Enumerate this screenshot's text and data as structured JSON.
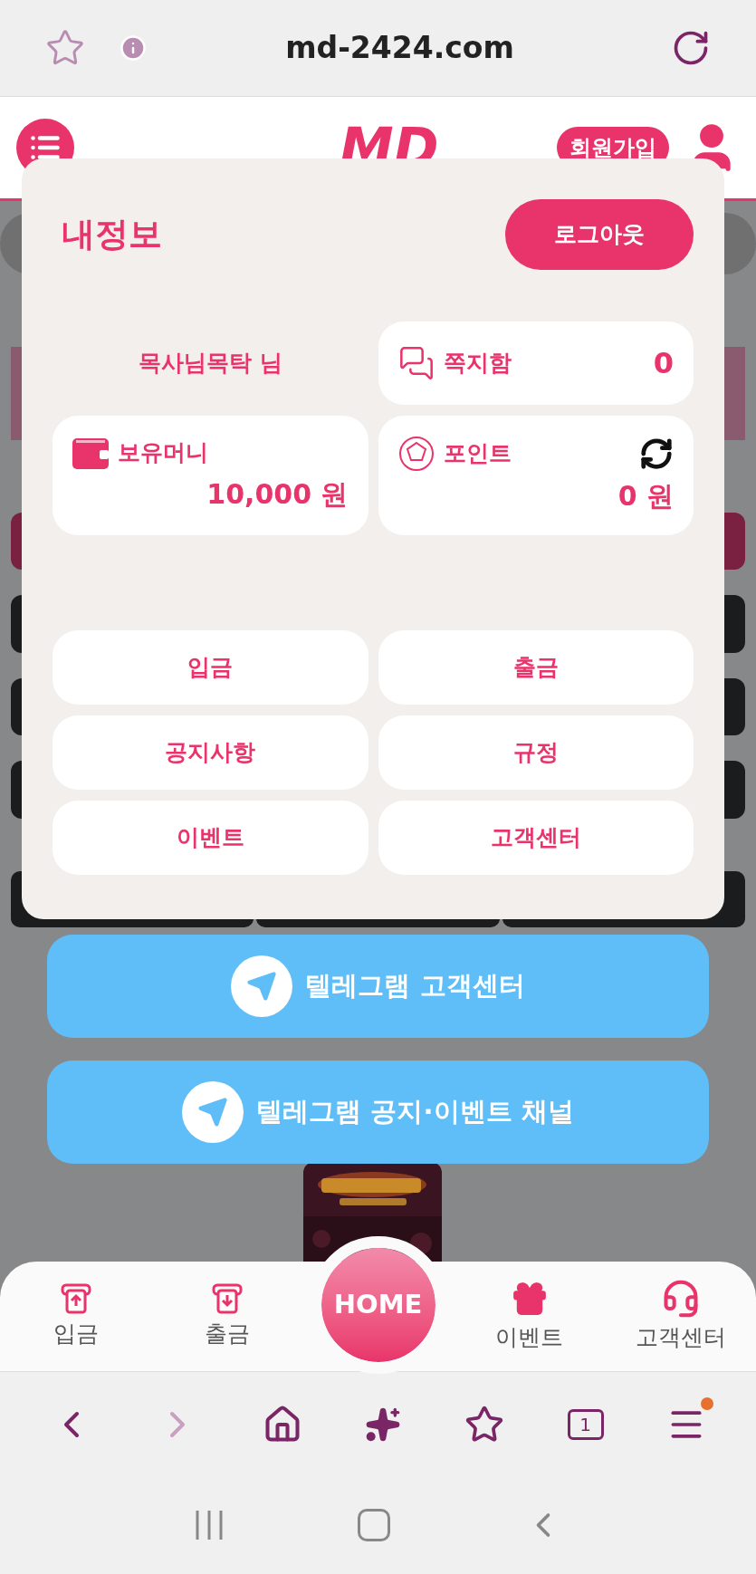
{
  "browser": {
    "url": "md-2424.com",
    "tab_count": "1"
  },
  "header": {
    "logo": "MD",
    "signup_button": "회원가입"
  },
  "panel": {
    "title": "내정보",
    "logout_button": "로그아웃",
    "username": "목사님목탁 님",
    "messages": {
      "label": "쪽지함",
      "count": "0"
    },
    "money": {
      "label": "보유머니",
      "amount": "10,000 원"
    },
    "points": {
      "label": "포인트",
      "amount": "0 원"
    },
    "menu_buttons": [
      "입금",
      "출금",
      "공지사항",
      "규정",
      "이벤트",
      "고객센터"
    ]
  },
  "telegram_buttons": [
    "텔레그램 고객센터",
    "텔레그램 공지·이벤트 채널"
  ],
  "bottom_nav": [
    {
      "kind": "deposit",
      "label": "입금"
    },
    {
      "kind": "withdraw",
      "label": "출금"
    },
    {
      "kind": "home",
      "label": "HOME"
    },
    {
      "kind": "event",
      "label": "이벤트"
    },
    {
      "kind": "support",
      "label": "고객센터"
    }
  ]
}
